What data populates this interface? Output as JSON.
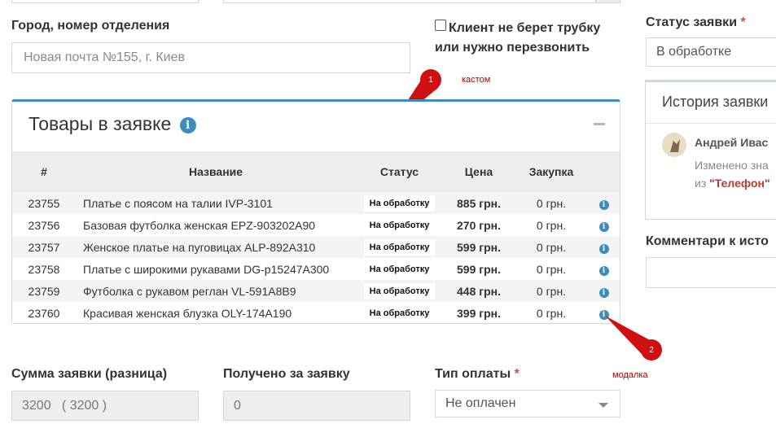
{
  "top_inputs": [
    "",
    "",
    ""
  ],
  "city": {
    "label": "Город, номер отделения",
    "placeholder": "Новая почта №155, г. Киев"
  },
  "callback": {
    "label_line1": "Клиент не берет трубку",
    "label_line2": "или нужно перезвонить",
    "checked": false
  },
  "status": {
    "label": "Статус заявки",
    "required_mark": "*",
    "value": "В обработке"
  },
  "products": {
    "title": "Товары в заявке",
    "info_icon": "i",
    "columns": [
      "#",
      "Название",
      "Статус",
      "Цена",
      "Закупка"
    ],
    "rows": [
      {
        "id": "23755",
        "name": "Платье с поясом на талии IVP-3101",
        "status": "На обработку",
        "price": "885 грн.",
        "purchase": "0 грн."
      },
      {
        "id": "23756",
        "name": "Базовая футболка женская EPZ-903202A90",
        "status": "На обработку",
        "price": "270 грн.",
        "purchase": "0 грн."
      },
      {
        "id": "23757",
        "name": "Женское платье на пуговицах ALP-892A310",
        "status": "На обработку",
        "price": "599 грн.",
        "purchase": "0 грн."
      },
      {
        "id": "23758",
        "name": "Платье с широкими рукавами DG-p15247A300",
        "status": "На обработку",
        "price": "599 грн.",
        "purchase": "0 грн."
      },
      {
        "id": "23759",
        "name": "Футболка с рукавом реглан VL-591A8B9",
        "status": "На обработку",
        "price": "448 грн.",
        "purchase": "0 грн."
      },
      {
        "id": "23760",
        "name": "Красивая женская блузка OLY-174A190",
        "status": "На обработку",
        "price": "399 грн.",
        "purchase": "0 грн."
      }
    ]
  },
  "annotations": [
    {
      "number": "1",
      "text": "кастом"
    },
    {
      "number": "2",
      "text": "модалка"
    }
  ],
  "history": {
    "title": "История заявки",
    "user": "Андрей Иваc",
    "line1": "Изменено зна",
    "line2_prefix": "из",
    "line2_value": "\"Телефон\""
  },
  "comments": {
    "label": "Комментари к исто"
  },
  "sum": {
    "label": "Сумма заявки (разница)",
    "value": "3200   ( 3200 )"
  },
  "received": {
    "label": "Получено за заявку",
    "value": "0"
  },
  "payment": {
    "label": "Тип оплаты",
    "required_mark": "*",
    "value": "Не оплачен"
  },
  "colors": {
    "accent": "#3c8dbc",
    "required": "#dd4b39",
    "annotation": "#d01010"
  }
}
